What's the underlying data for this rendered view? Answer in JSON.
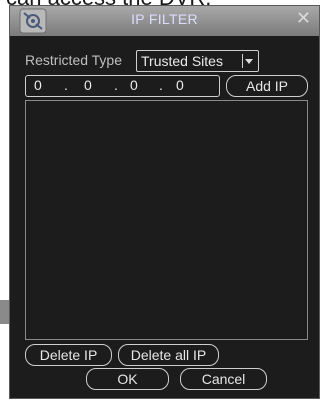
{
  "caption": "can access the DVR.",
  "dialog": {
    "title": "IP FILTER",
    "icons": {
      "app": "settings-tool-icon",
      "close": "close-icon"
    }
  },
  "restricted_type": {
    "label": "Restricted Type",
    "selected": "Trusted Sites"
  },
  "ip_input": {
    "octets": [
      "0",
      "0",
      "0",
      "0"
    ],
    "separator": "."
  },
  "buttons": {
    "add_ip": "Add IP",
    "delete_ip": "Delete IP",
    "delete_all_ip": "Delete all IP",
    "ok": "OK",
    "cancel": "Cancel"
  },
  "ip_list": {
    "items": []
  },
  "colors": {
    "dialog_bg": "#1c1c1c",
    "title_text": "#dcdcff",
    "border": "#cfcfcf"
  }
}
